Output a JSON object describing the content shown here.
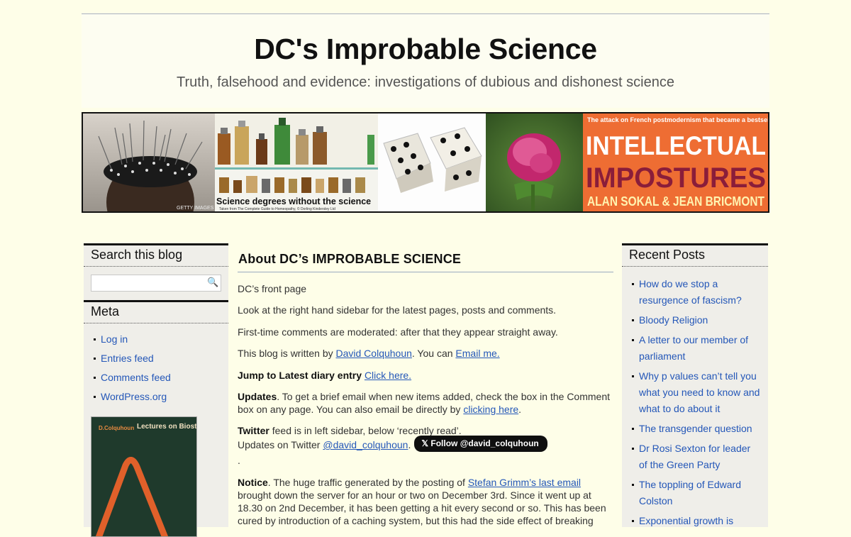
{
  "header": {
    "title": "DC's Improbable Science",
    "tagline": "Truth, falsehood and evidence: investigations of dubious and dishonest science"
  },
  "banner": {
    "acupuncture_credit": "GETTY IMAGES",
    "bottles_caption": "Science degrees without the science",
    "bottles_credit": "Taken from The Complete Guide to Homeopathy, © Dorling Kindersley Ltd",
    "book_tagline": "The attack on French postmodernism that became a bestseller",
    "book_title_1": "INTELLECTUAL",
    "book_title_2": "IMPOSTURES",
    "book_authors": "ALAN SOKAL & JEAN BRICMONT"
  },
  "sidebar_left": {
    "search_title": "Search this blog",
    "search_value": "",
    "meta_title": "Meta",
    "meta_links": [
      "Log in",
      "Entries feed",
      "Comments feed",
      "WordPress.org"
    ],
    "book_author": "D.Colquhoun",
    "book_title": "Lectures on Biostatistics"
  },
  "content": {
    "title": "About DC’s IMPROBABLE SCIENCE",
    "p1": "DC’s front page",
    "p2": "Look at the right hand sidebar for the latest pages, posts and comments.",
    "p3": "First-time comments are moderated: after that they appear straight away.",
    "p4_pre": "This blog is written by ",
    "p4_link1": "David Colquhoun",
    "p4_mid": ". You can ",
    "p4_link2": "Email me.",
    "p5_bold": "Jump to Latest diary entry",
    "p5_link": "Click here.",
    "p6_bold": "Updates",
    "p6_text": ". To get a brief email when new items added, check the box in the Comment box on any page. You can also email be directly by ",
    "p6_link": "clicking here",
    "p6_end": ".",
    "p7_bold": "Twitter",
    "p7_text": " feed is in left sidebar, below ‘recently read’.",
    "p8_pre": "Updates on Twitter ",
    "p8_link": "@david_colquhoun",
    "p8_end": ".",
    "twitter_button": "Follow @david_colquhoun",
    "p9": ".",
    "p10_bold": "Notice",
    "p10_text": ". The huge traffic generated by the posting of ",
    "p10_link": "Stefan Grimm’s last email",
    "p10_rest": " brought down the server for an hour or two on December 3rd. Since it went up at 18.30 on 2nd December, it has been getting a hit every second or so. This has been cured by introduction of a caching system, but this had the side effect of breaking"
  },
  "sidebar_right": {
    "title": "Recent Posts",
    "posts": [
      "How do we stop a resurgence of fascism?",
      "Bloody Religion",
      "A letter to our member of parliament",
      "Why p values can’t tell you what you need to know and what to do about it",
      "The transgender question",
      "Dr Rosi Sexton for leader of the Green Party",
      "The toppling of Edward Colston",
      "Exponential growth is"
    ]
  },
  "colors": {
    "page_background": "#fefee8",
    "link": "#2457b8",
    "sidebar_background": "#efeee9"
  }
}
